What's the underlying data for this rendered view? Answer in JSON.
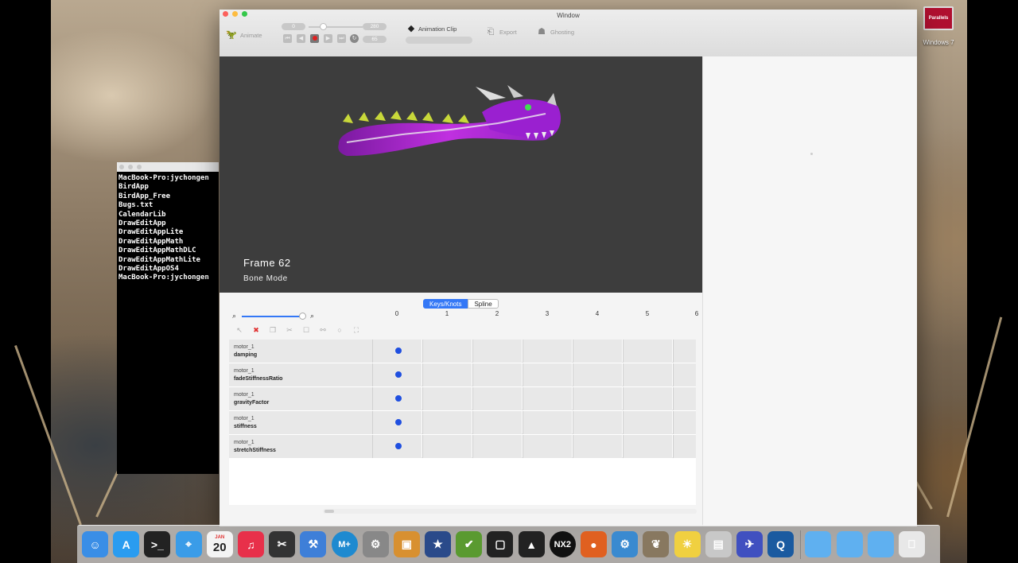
{
  "desktop": {
    "parallels": {
      "label": "Windows 7",
      "badge": "Parallels"
    }
  },
  "terminal": {
    "lines": [
      "MacBook-Pro:jychongen",
      "BirdApp",
      "BirdApp_Free",
      "Bugs.txt",
      "CalendarLib",
      "DrawEditApp",
      "DrawEditAppLite",
      "DrawEditAppMath",
      "DrawEditAppMathDLC",
      "DrawEditAppMathLite",
      "DrawEditAppOS4",
      "MacBook-Pro:jychongen"
    ]
  },
  "window": {
    "title": "Window",
    "toolbar": {
      "animate_label": "Animate",
      "start_frame": "0",
      "end_frame": "280",
      "fps": "65",
      "animation_clip_label": "Animation Clip",
      "clip_select": "",
      "export_label": "Export",
      "ghosting_label": "Ghosting"
    },
    "canvas": {
      "frame_label": "Frame 62",
      "mode_label": "Bone Mode"
    },
    "timeline": {
      "tabs": [
        "Keys/Knots",
        "Spline"
      ],
      "active_tab": "Keys/Knots",
      "frame_ticks": [
        "0",
        "1",
        "2",
        "3",
        "4",
        "5",
        "6"
      ],
      "tracks": [
        {
          "object": "motor_1",
          "property": "damping"
        },
        {
          "object": "motor_1",
          "property": "fadeStiffnessRatio"
        },
        {
          "object": "motor_1",
          "property": "gravityFactor"
        },
        {
          "object": "motor_1",
          "property": "stiffness"
        },
        {
          "object": "motor_1",
          "property": "stretchStiffness"
        }
      ]
    }
  },
  "dock": {
    "items": [
      "finder",
      "app-store",
      "terminal",
      "safari",
      "calendar",
      "itunes",
      "final-cut",
      "xcode",
      "mail-plus",
      "system-preferences",
      "preview",
      "imovie",
      "instruments",
      "screen-capture",
      "inkscape",
      "nx2",
      "firefox",
      "automator",
      "gimp",
      "cyberduck",
      "image-capture",
      "jaunt",
      "quicktime",
      "folder",
      "folder",
      "downloads",
      "trash"
    ],
    "calendar_month": "JAN",
    "calendar_day": "20",
    "mail_badge": "M+",
    "nx_label": "NX2",
    "accent": "#3478f6"
  }
}
